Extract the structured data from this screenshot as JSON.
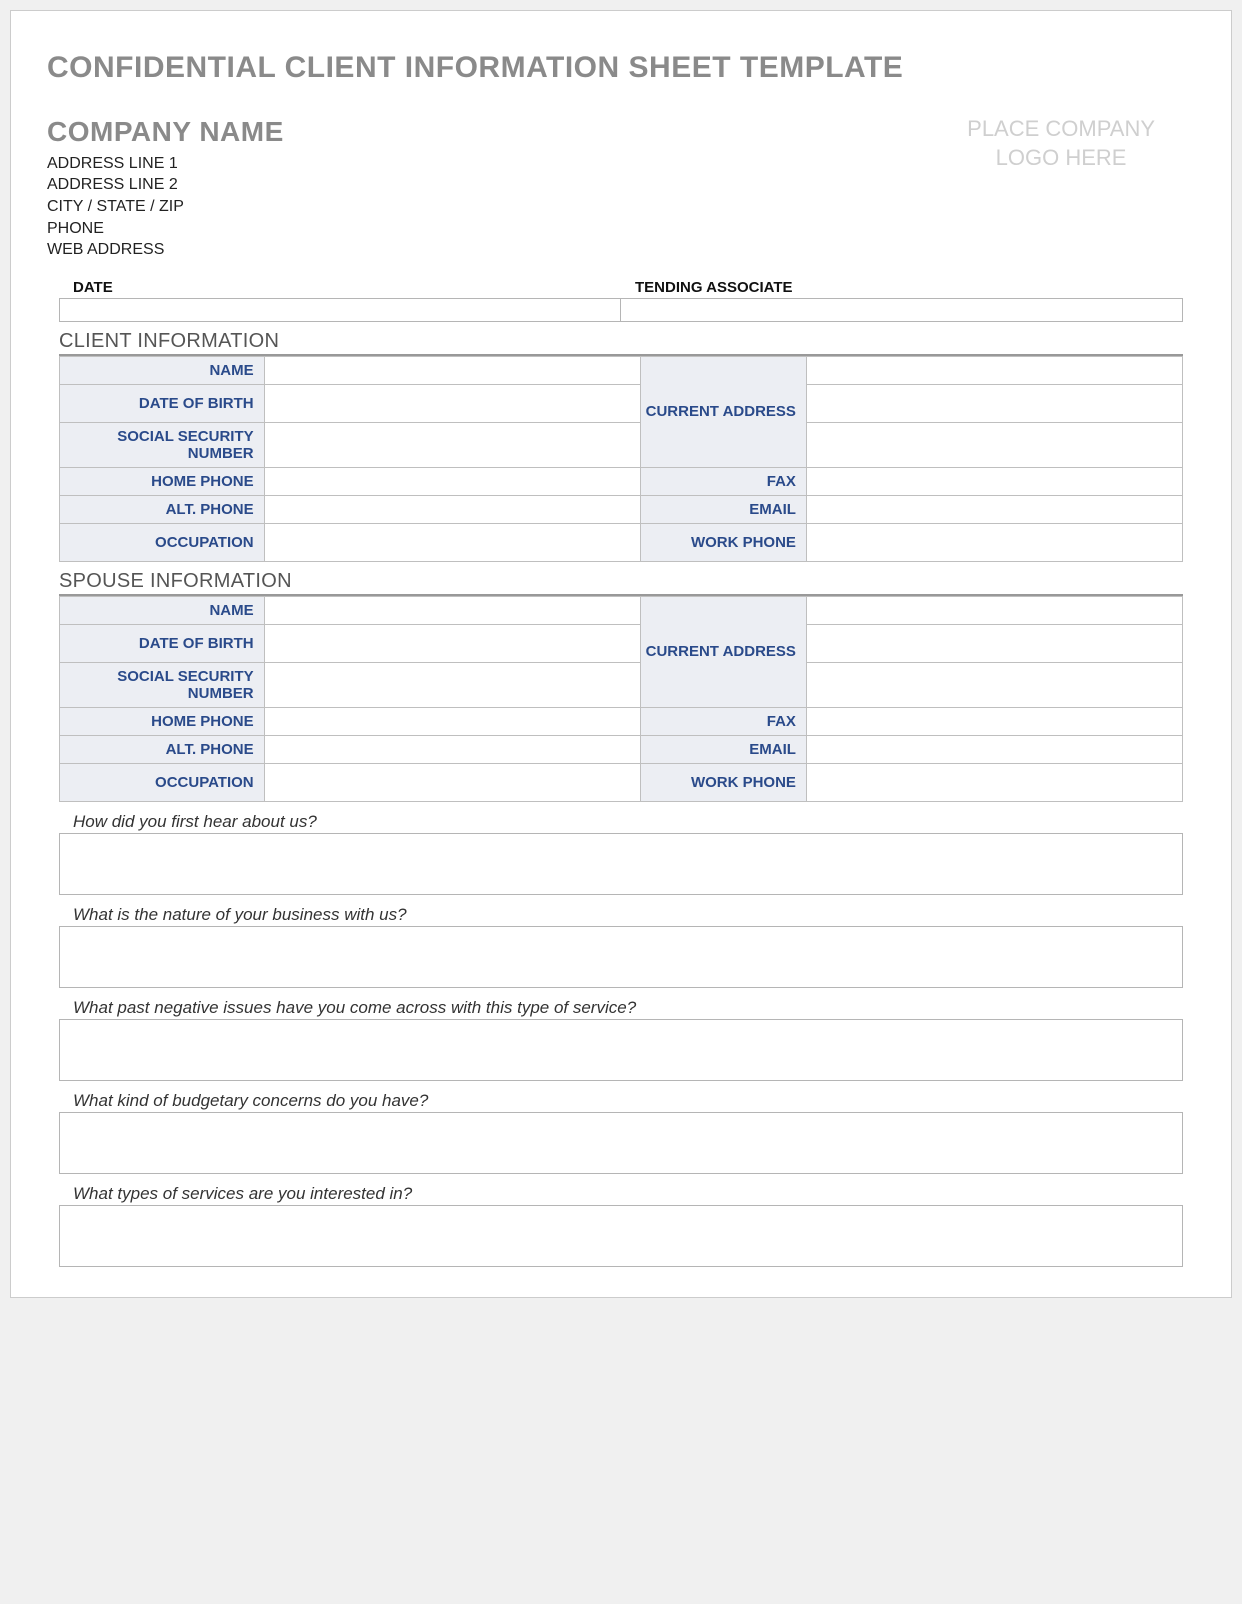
{
  "doc_title": "CONFIDENTIAL CLIENT INFORMATION SHEET TEMPLATE",
  "company": {
    "name": "COMPANY NAME",
    "lines": [
      "ADDRESS LINE 1",
      "ADDRESS LINE 2",
      "CITY / STATE / ZIP",
      "PHONE",
      "WEB ADDRESS"
    ]
  },
  "logo_placeholder": {
    "line1": "PLACE COMPANY",
    "line2": "LOGO HERE"
  },
  "topfields": {
    "date_label": "DATE",
    "associate_label": "TENDING ASSOCIATE"
  },
  "sections": {
    "client": {
      "title": "CLIENT INFORMATION",
      "labels": {
        "name": "NAME",
        "dob": "DATE OF BIRTH",
        "ssn": "SOCIAL SECURITY NUMBER",
        "home_phone": "HOME PHONE",
        "alt_phone": "ALT. PHONE",
        "occupation": "OCCUPATION",
        "current_address": "CURRENT ADDRESS",
        "fax": "FAX",
        "email": "EMAIL",
        "work_phone": "WORK PHONE"
      }
    },
    "spouse": {
      "title": "SPOUSE INFORMATION",
      "labels": {
        "name": "NAME",
        "dob": "DATE OF BIRTH",
        "ssn": "SOCIAL SECURITY NUMBER",
        "home_phone": "HOME PHONE",
        "alt_phone": "ALT. PHONE",
        "occupation": "OCCUPATION",
        "current_address": "CURRENT ADDRESS",
        "fax": "FAX",
        "email": "EMAIL",
        "work_phone": "WORK PHONE"
      }
    }
  },
  "questions": [
    "How did you first hear about us?",
    "What is the nature of your business with us?",
    "What past negative issues have you come across with this type of service?",
    "What kind of budgetary concerns do you have?",
    "What types of services are you interested in?"
  ]
}
